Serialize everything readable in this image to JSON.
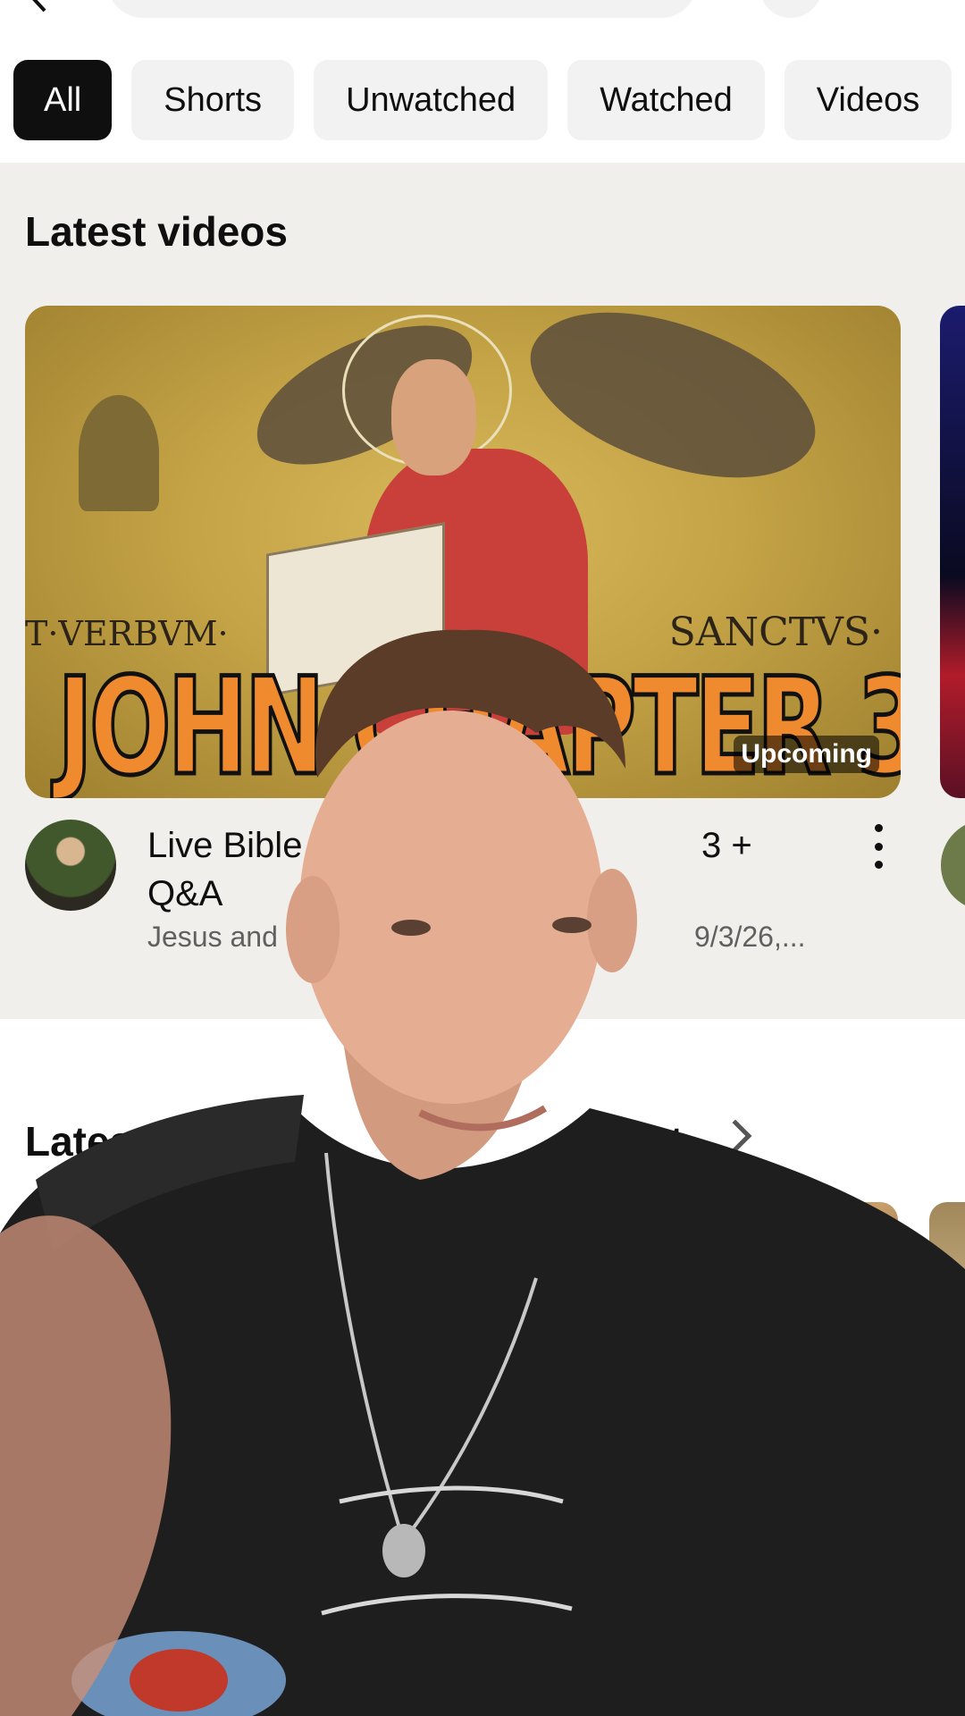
{
  "filters": {
    "chips": [
      "All",
      "Shorts",
      "Unwatched",
      "Watched",
      "Videos"
    ],
    "active": "All"
  },
  "latest_videos": {
    "title": "Latest videos",
    "video": {
      "thumbnail_text": "JOHN CHAPTER 3",
      "thumbnail_latin_left": "T·VERBVM·",
      "thumbnail_latin_right": "SANCTVS·",
      "badge": "Upcoming",
      "title_line1": "Live Bible",
      "title_line1_right": "3 +",
      "title_line2": "Q&A",
      "meta_left": "Jesus and",
      "meta_right": "9/3/26,..."
    }
  },
  "latest_from": {
    "title_left": "Latest f",
    "title_right": "tnot"
  },
  "icons": {
    "back": "back-arrow-icon",
    "mic": "mic-icon",
    "cast": "more-icon",
    "kebab": "more-vert-icon",
    "chevron": "chevron-right-icon"
  }
}
